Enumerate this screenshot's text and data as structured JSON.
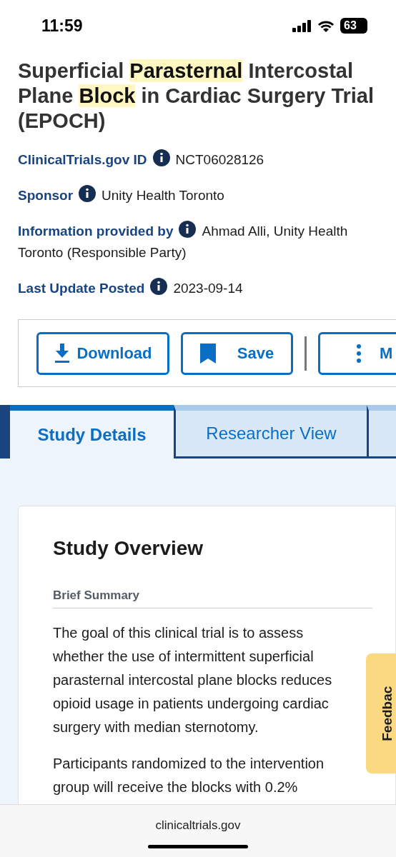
{
  "status_bar": {
    "time": "11:59",
    "battery": "63"
  },
  "title": "Superficial **Parasternal** Intercostal Plane **Block** in Cardiac Surgery Trial (EPOCH)",
  "meta": [
    {
      "label": "ClinicalTrials.gov ID",
      "value": "NCT06028126"
    },
    {
      "label": "Sponsor",
      "value": "Unity Health Toronto"
    },
    {
      "label": "Information provided by",
      "value": "Ahmad Alli, Unity Health Toronto (Responsible Party)"
    },
    {
      "label": "Last Update Posted",
      "value": "2023-09-14"
    }
  ],
  "actions": [
    {
      "kind": "download",
      "label": "Download"
    },
    {
      "kind": "save",
      "label": "Save"
    },
    {
      "kind": "more",
      "label": "M"
    }
  ],
  "tabs": [
    {
      "label": "Study Details",
      "selected": true
    },
    {
      "label": "Researcher View",
      "selected": false
    },
    {
      "selected": false
    }
  ],
  "section": {
    "title": "Study Overview",
    "subtitle": "Brief Summary",
    "paragraphs": [
      "The goal of this clinical trial is to assess whether the use of intermittent superficial parasternal intercostal plane blocks reduces opioid usage in patients undergoing cardiac surgery with median sternotomy.",
      "Participants randomized to the intervention group will receive the blocks with 0.2%"
    ]
  },
  "feedback": {
    "label": "Feedbac"
  },
  "address_bar": {
    "url": "clinicaltrials.gov"
  }
}
